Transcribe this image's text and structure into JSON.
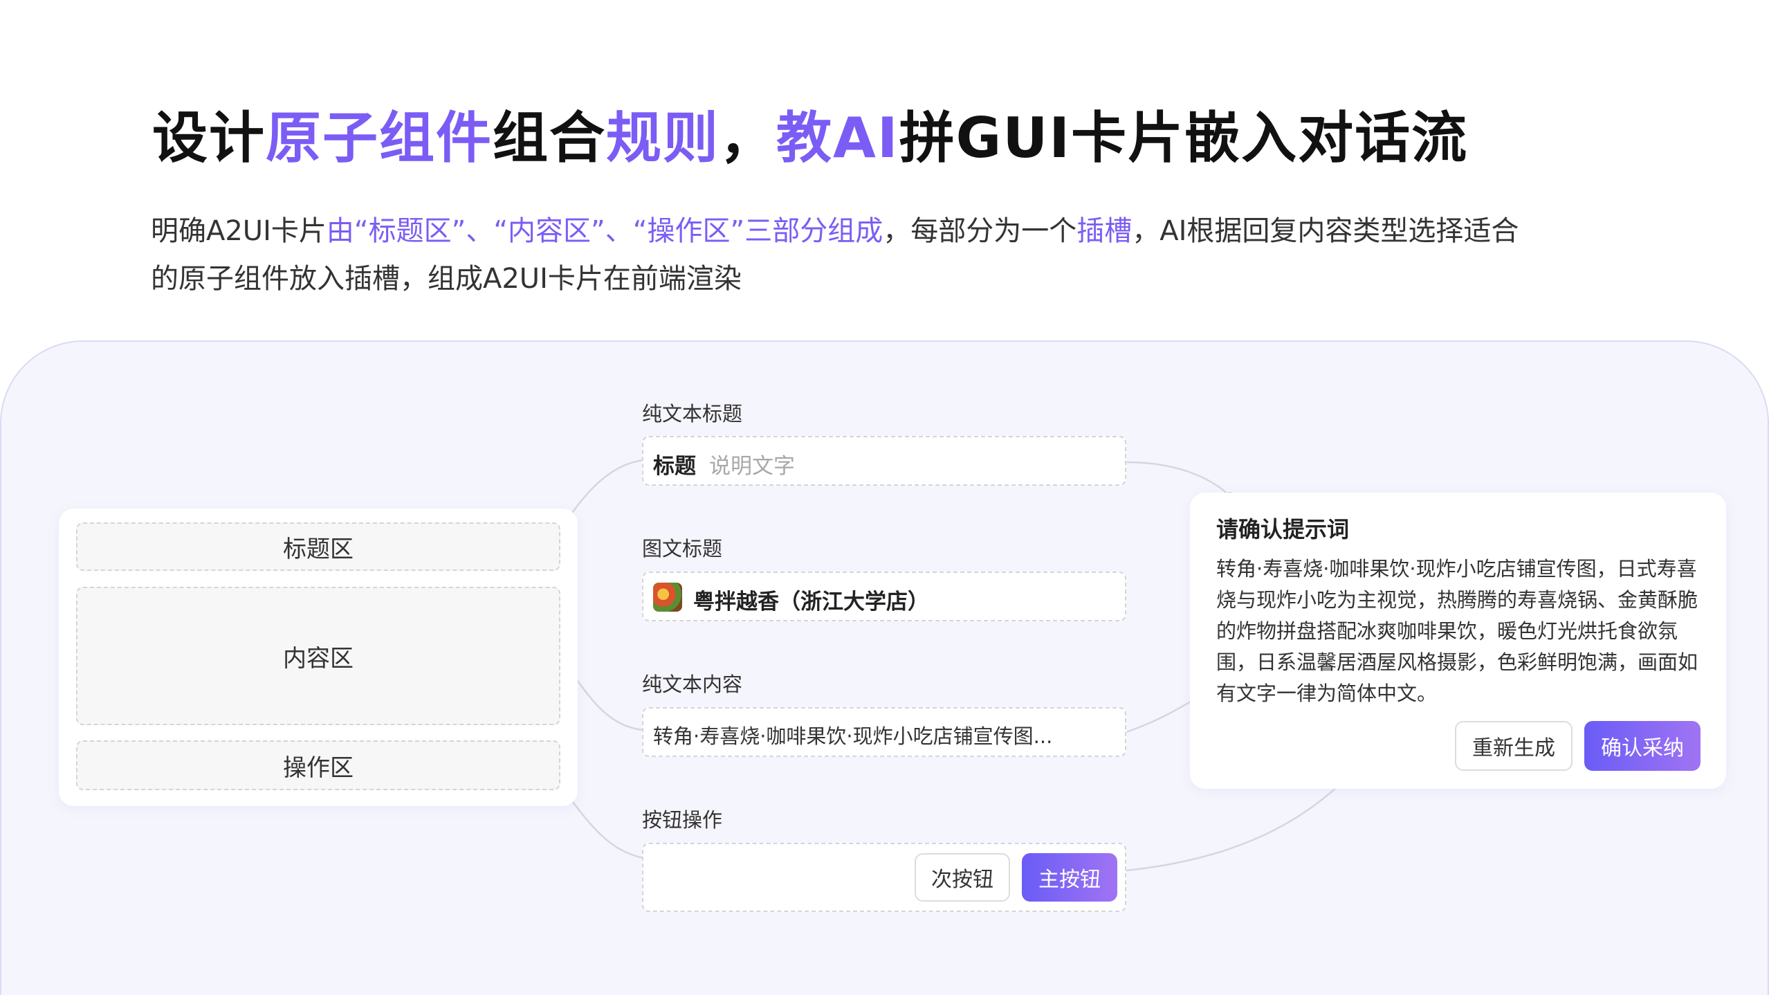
{
  "header": {
    "title_parts": [
      "设计",
      "原子组件",
      "组合",
      "规则",
      "，",
      "教AI",
      "拼GUI卡片嵌入对话流"
    ],
    "desc_line1_parts": [
      "明确A2UI卡片",
      "由“标题区”、“内容区”、“操作区”三部分组成",
      "，每部分为一个",
      "插槽",
      "，AI根据回复内容类型选择适合"
    ],
    "desc_line2": "的原子组件放入插槽，组成A2UI卡片在前端渲染"
  },
  "card_structure": {
    "zones": [
      "标题区",
      "内容区",
      "操作区"
    ]
  },
  "slots": {
    "plain_title": {
      "label": "纯文本标题",
      "title": "标题",
      "caption": "说明文字"
    },
    "image_title": {
      "label": "图文标题",
      "icon": "food-photo-icon",
      "text": "粤拌越香（浙江大学店）"
    },
    "plain_content": {
      "label": "纯文本内容",
      "text": "转角·寿喜烧·咖啡果饮·现炸小吃店铺宣传图..."
    },
    "button_action": {
      "label": "按钮操作",
      "secondary": "次按钮",
      "primary": "主按钮"
    }
  },
  "example_card": {
    "heading": "请确认提示词",
    "body": "转角·寿喜烧·咖啡果饮·现炸小吃店铺宣传图，日式寿喜烧与现炸小吃为主视觉，热腾腾的寿喜烧锅、金黄酥脆的炸物拼盘搭配冰爽咖啡果饮，暖色灯光烘托食欲氛围，日系温馨居酒屋风格摄影，色彩鲜明饱满，画面如有文字一律为简体中文。",
    "secondary_button": "重新生成",
    "primary_button": "确认采纳"
  },
  "colors": {
    "accent": "#7b5cf5",
    "canvas_bg": "#f5f5fd",
    "primary_gradient_start": "#6a5cf6",
    "primary_gradient_end": "#a074f3",
    "connector": "#d6d6e2"
  }
}
